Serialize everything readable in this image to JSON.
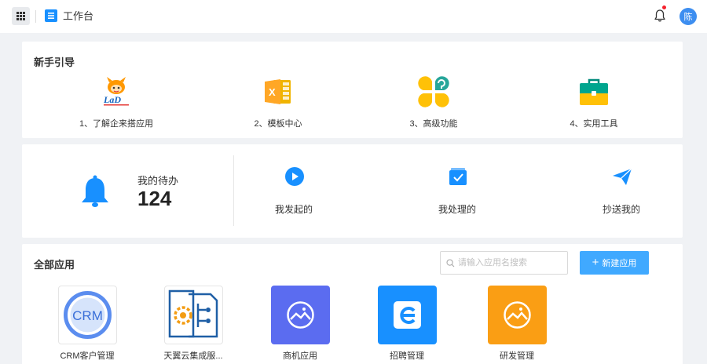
{
  "header": {
    "app_title": "工作台",
    "avatar_text": "陈",
    "has_notification": true
  },
  "guide": {
    "title": "新手引导",
    "items": [
      {
        "label": "1、了解企来搭应用",
        "icon": "lad-mascot-icon"
      },
      {
        "label": "2、模板中心",
        "icon": "excel-template-icon"
      },
      {
        "label": "3、高级功能",
        "icon": "advanced-features-icon"
      },
      {
        "label": "4、实用工具",
        "icon": "toolbox-icon"
      }
    ]
  },
  "todo": {
    "label": "我的待办",
    "count": "124",
    "actions": [
      {
        "label": "我发起的",
        "icon": "play-circle-icon"
      },
      {
        "label": "我处理的",
        "icon": "task-check-icon"
      },
      {
        "label": "抄送我的",
        "icon": "paper-plane-icon"
      }
    ]
  },
  "apps": {
    "title": "全部应用",
    "search_placeholder": "请输入应用名搜索",
    "search_value": "",
    "new_button_label": "新建应用",
    "items": [
      {
        "label": "CRM客户管理",
        "icon": "crm-logo-icon",
        "logo_text": "CRM"
      },
      {
        "label": "天翼云集成服...",
        "icon": "integration-service-icon"
      },
      {
        "label": "商机应用",
        "icon": "image-icon",
        "color": "#5b6cf0"
      },
      {
        "label": "招聘管理",
        "icon": "e-letter-icon",
        "color": "#1890ff"
      },
      {
        "label": "研发管理",
        "icon": "image-icon",
        "color": "#fa9e14"
      }
    ]
  },
  "colors": {
    "primary": "#1890ff",
    "button": "#40a9ff",
    "background": "#f0f2f5",
    "notification": "#f5222d"
  }
}
